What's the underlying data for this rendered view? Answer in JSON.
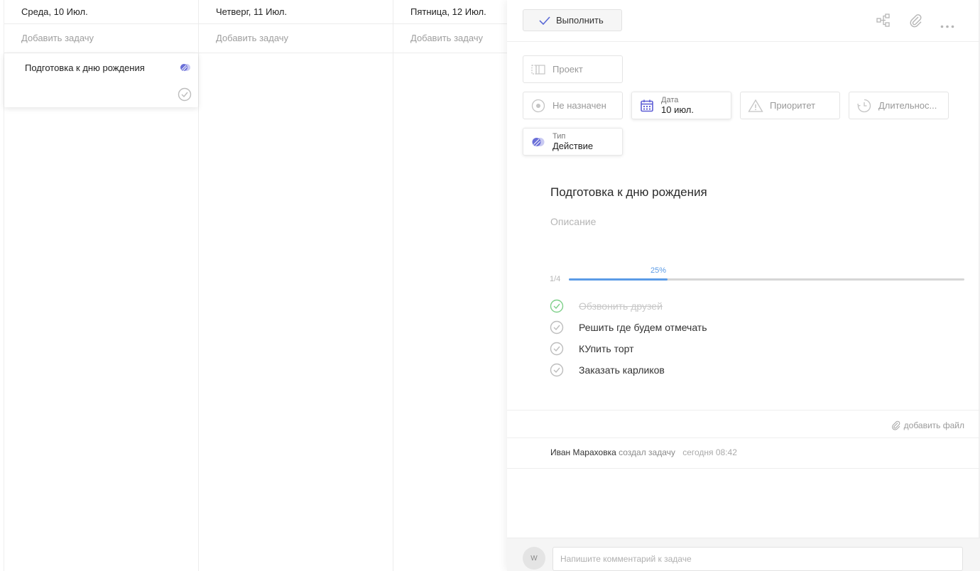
{
  "board": {
    "columns": [
      {
        "header": "Среда, 10 Июл.",
        "add_label": "Добавить задачу"
      },
      {
        "header": "Четверг, 11 Июл.",
        "add_label": "Добавить задачу"
      },
      {
        "header": "Пятница, 12 Июл.",
        "add_label": "Добавить задачу"
      }
    ],
    "card": {
      "title": "Подготовка к дню рождения",
      "type_icon": "action-type-icon",
      "check_icon": "check-circle-icon"
    }
  },
  "panel": {
    "toolbar": {
      "done_label": "Выполнить",
      "icons": [
        "subtasks-tree-icon",
        "paperclip-icon",
        "more-dots-icon"
      ]
    },
    "fields": {
      "project": {
        "placeholder": "Проект"
      },
      "assignee": {
        "placeholder": "Не назначен"
      },
      "date": {
        "label": "Дата",
        "value": "10 июл."
      },
      "priority": {
        "placeholder": "Приоритет"
      },
      "duration": {
        "placeholder": "Длительнос..."
      },
      "type": {
        "label": "Тип",
        "value": "Действие"
      }
    },
    "task": {
      "title": "Подготовка к дню рождения",
      "description_placeholder": "Описание"
    },
    "checklist": {
      "count": "1/4",
      "percent_label": "25%",
      "progress": 0.25,
      "items": [
        {
          "label": "Обзвонить друзей",
          "done": true
        },
        {
          "label": "Решить где будем отмечать",
          "done": false
        },
        {
          "label": "КУпить торт",
          "done": false
        },
        {
          "label": "Заказать карликов",
          "done": false
        }
      ]
    },
    "attach": {
      "label": "добавить файл"
    },
    "activity": {
      "user": "Иван Мараховка",
      "verb": "создал задачу",
      "time": "сегодня 08:42"
    },
    "comment": {
      "avatar_initial": "W",
      "placeholder": "Напишите комментарий к задаче"
    }
  },
  "colors": {
    "accent": "#5b9be6",
    "type_purple": "#6a6fd8",
    "done_green": "#7fd08a",
    "date_icon": "#5f5fd6"
  }
}
